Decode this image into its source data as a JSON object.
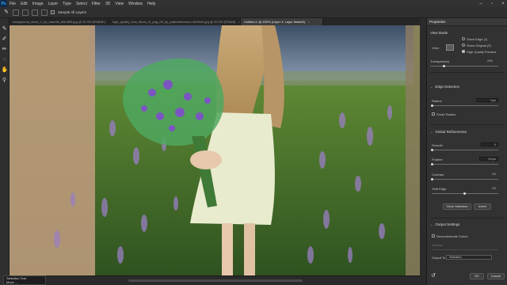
{
  "menubar": {
    "logo": "Ps",
    "items": [
      "File",
      "Edit",
      "Image",
      "Layer",
      "Type",
      "Select",
      "Filter",
      "3D",
      "View",
      "Window",
      "Help"
    ]
  },
  "options": {
    "sample_all_layers": "Sample All Layers"
  },
  "tabs": [
    {
      "label": "background_stock_1_by_hauntid_d0b4f53.jpg @ 33.3% (RGB/8*)",
      "active": false
    },
    {
      "label": "high_quality_lens_flares_in_png_09_by_pattodeleveaux-d5d9nfe.jpg @ 33.3% (RGB/8)",
      "active": false
    },
    {
      "label": "Untitled-1 @ 400% (Layer 4, Layer Mask/8)",
      "active": true
    }
  ],
  "panel": {
    "title": "Properties",
    "view_mode": {
      "title": "View Mode",
      "view_label": "View:",
      "show_edge": "Show Edge (J)",
      "show_original": "Show Original (P)",
      "high_quality_preview": "High Quality Preview"
    },
    "transparency": {
      "label": "Transparency",
      "value": "20%",
      "fraction": 0.2
    },
    "edge_detection": {
      "title": "Edge Detection",
      "radius_label": "Radius",
      "radius_value": "0 px",
      "smart_radius": "Smart Radius"
    },
    "global_refinements": {
      "title": "Global Refinements",
      "smooth_label": "Smooth",
      "smooth_value": "0",
      "feather_label": "Feather",
      "feather_value": "0.0 px",
      "contrast_label": "Contrast",
      "contrast_value": "0%",
      "shift_edge_label": "Shift Edge",
      "shift_edge_value": "0%"
    },
    "clear_selection": "Clear Selection",
    "invert": "Invert",
    "output_settings": {
      "title": "Output Settings",
      "decontaminate": "Decontaminate Colors",
      "amount_label": "Amount",
      "output_to_label": "Output To",
      "output_to_value": "Selection"
    },
    "ok": "OK",
    "cancel": "Cancel"
  },
  "taskbar_popup": {
    "line1": "Selection Tool",
    "line2": "Move ..."
  },
  "colors": {
    "accent": "#31a8ff",
    "panel_bg": "#323232",
    "app_bg": "#2b2b2b"
  }
}
